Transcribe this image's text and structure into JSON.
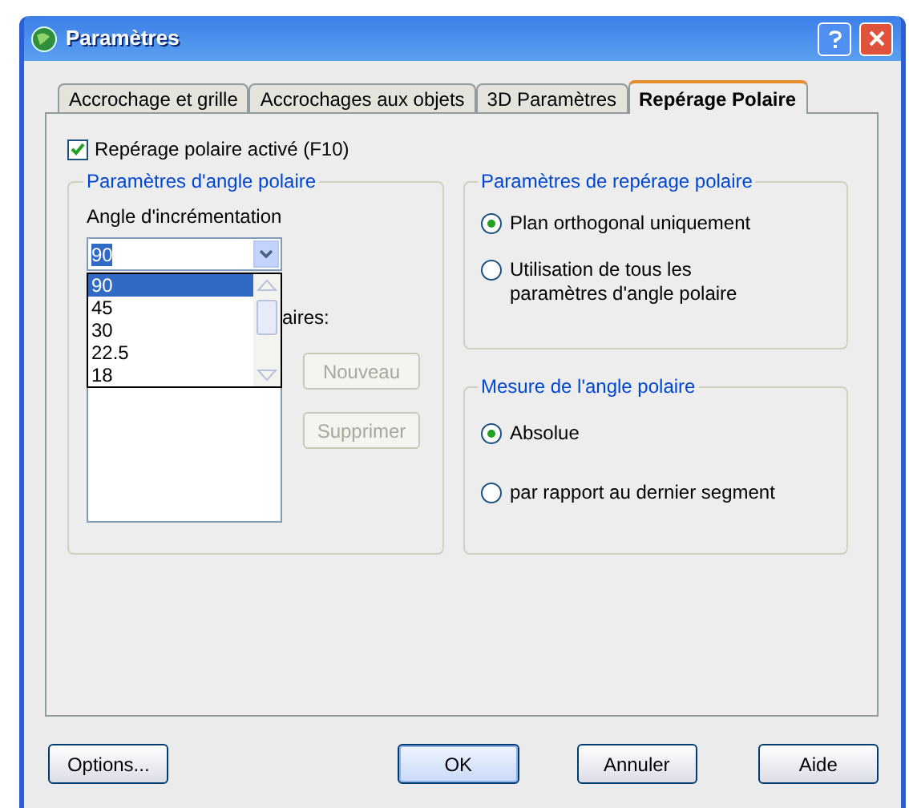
{
  "window": {
    "title": "Paramètres"
  },
  "tabs": [
    {
      "label": "Accrochage et grille",
      "selected": false
    },
    {
      "label": "Accrochages aux objets",
      "selected": false
    },
    {
      "label": "3D Paramètres",
      "selected": false
    },
    {
      "label": "Repérage Polaire",
      "selected": true
    }
  ],
  "enable_checkbox": {
    "label": "Repérage polaire activé (F10)",
    "checked": true
  },
  "angle_group": {
    "title": "Paramètres d'angle polaire",
    "increment_label": "Angle d'incrémentation",
    "increment_combo": {
      "value": "90",
      "expanded": true,
      "options": [
        {
          "label": "90",
          "selected": true
        },
        {
          "label": "45",
          "selected": false
        },
        {
          "label": "30",
          "selected": false
        },
        {
          "label": "22.5",
          "selected": false
        },
        {
          "label": "18",
          "selected": false
        }
      ]
    },
    "additional_label": "aires:",
    "buttons": [
      {
        "label": "Nouveau",
        "disabled": true
      },
      {
        "label": "Supprimer",
        "disabled": true
      }
    ]
  },
  "tracking_group": {
    "title": "Paramètres de repérage polaire",
    "options": [
      {
        "label": "Plan orthogonal uniquement",
        "selected": true
      },
      {
        "label": "Utilisation de tous les paramètres d'angle polaire",
        "selected": false
      }
    ]
  },
  "measure_group": {
    "title": "Mesure de l'angle polaire",
    "options": [
      {
        "label": "Absolue",
        "selected": true
      },
      {
        "label": "par rapport au dernier segment",
        "selected": false
      }
    ]
  },
  "buttons": [
    {
      "label": "Options...",
      "default": false
    },
    {
      "label": "OK",
      "default": true
    },
    {
      "label": "Annuler",
      "default": false
    },
    {
      "label": "Aide",
      "default": false
    }
  ]
}
